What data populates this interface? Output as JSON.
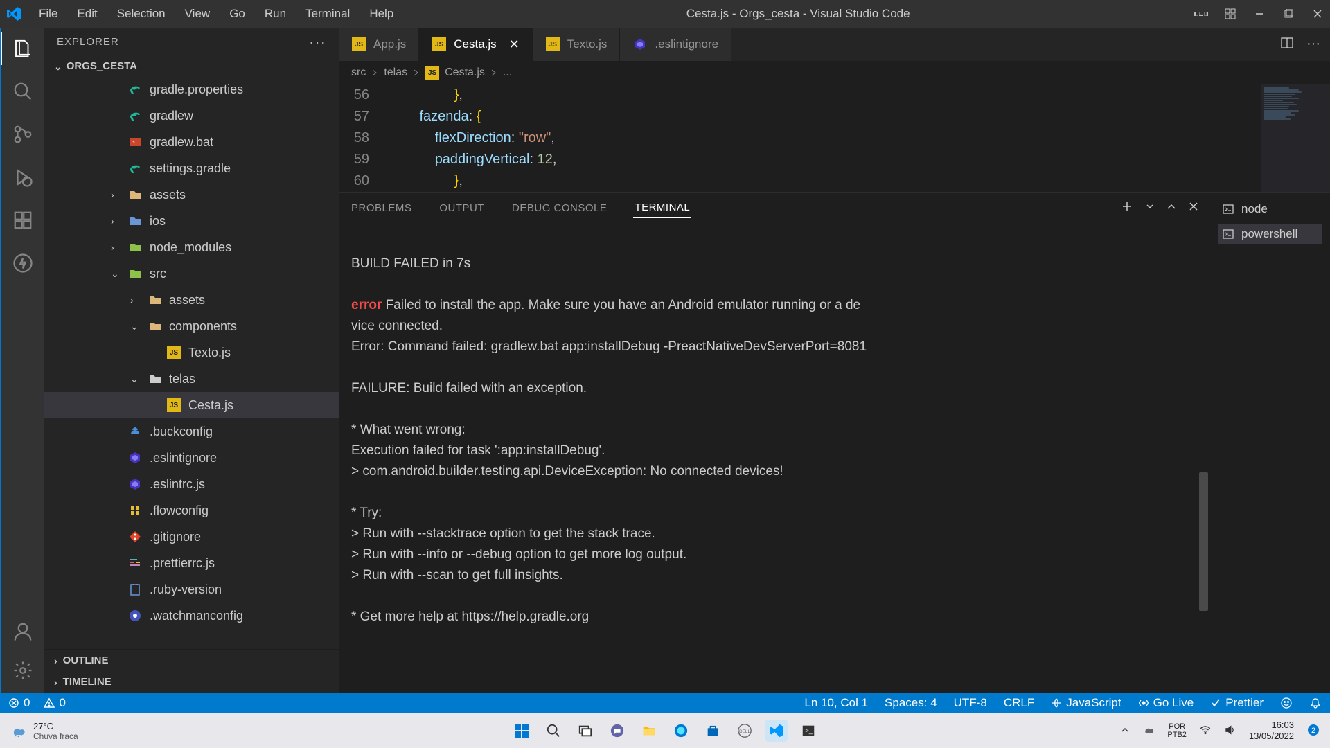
{
  "menu": [
    "File",
    "Edit",
    "Selection",
    "View",
    "Go",
    "Run",
    "Terminal",
    "Help"
  ],
  "window_title": "Cesta.js - Orgs_cesta - Visual Studio Code",
  "sidebar": {
    "header": "EXPLORER",
    "root": "ORGS_CESTA",
    "outline": "OUTLINE",
    "timeline": "TIMELINE"
  },
  "tree": [
    {
      "name": "gradle.properties",
      "indent": 0,
      "type": "file",
      "icon": "gradle"
    },
    {
      "name": "gradlew",
      "indent": 0,
      "type": "file",
      "icon": "gradle"
    },
    {
      "name": "gradlew.bat",
      "indent": 0,
      "type": "file",
      "icon": "bat"
    },
    {
      "name": "settings.gradle",
      "indent": 0,
      "type": "file",
      "icon": "gradle"
    },
    {
      "name": "assets",
      "indent": 0,
      "type": "folder",
      "open": false,
      "chevron": true,
      "color": "#dcb67a"
    },
    {
      "name": "ios",
      "indent": 0,
      "type": "folder",
      "open": false,
      "chevron": true,
      "color": "#6997d5"
    },
    {
      "name": "node_modules",
      "indent": 0,
      "type": "folder",
      "open": false,
      "chevron": true,
      "color": "#8dc149"
    },
    {
      "name": "src",
      "indent": 0,
      "type": "folder",
      "open": true,
      "chevron": true,
      "color": "#8dc149"
    },
    {
      "name": "assets",
      "indent": 1,
      "type": "folder",
      "open": false,
      "chevron": true,
      "color": "#dcb67a"
    },
    {
      "name": "components",
      "indent": 1,
      "type": "folder",
      "open": true,
      "chevron": true,
      "color": "#dcb67a"
    },
    {
      "name": "Texto.js",
      "indent": 2,
      "type": "file",
      "icon": "js"
    },
    {
      "name": "telas",
      "indent": 1,
      "type": "folder",
      "open": true,
      "chevron": true,
      "color": "#cccccc"
    },
    {
      "name": "Cesta.js",
      "indent": 2,
      "type": "file",
      "icon": "js",
      "selected": true
    },
    {
      "name": ".buckconfig",
      "indent": 0,
      "type": "file",
      "icon": "buck"
    },
    {
      "name": ".eslintignore",
      "indent": 0,
      "type": "file",
      "icon": "eslint"
    },
    {
      "name": ".eslintrc.js",
      "indent": 0,
      "type": "file",
      "icon": "eslint"
    },
    {
      "name": ".flowconfig",
      "indent": 0,
      "type": "file",
      "icon": "flow"
    },
    {
      "name": ".gitignore",
      "indent": 0,
      "type": "file",
      "icon": "git"
    },
    {
      "name": ".prettierrc.js",
      "indent": 0,
      "type": "file",
      "icon": "prettier"
    },
    {
      "name": ".ruby-version",
      "indent": 0,
      "type": "file",
      "icon": "ruby"
    },
    {
      "name": ".watchmanconfig",
      "indent": 0,
      "type": "file",
      "icon": "watchman"
    }
  ],
  "tabs": [
    {
      "label": "App.js",
      "icon": "js"
    },
    {
      "label": "Cesta.js",
      "icon": "js",
      "active": true,
      "close": true
    },
    {
      "label": "Texto.js",
      "icon": "js"
    },
    {
      "label": ".eslintignore",
      "icon": "eslint"
    }
  ],
  "breadcrumb": {
    "parts": [
      "src",
      "telas",
      "Cesta.js"
    ],
    "tail": "..."
  },
  "code": [
    {
      "n": 56,
      "seg": [
        {
          "t": "            ",
          "c": ""
        },
        {
          "t": "}",
          "c": "c-brace"
        },
        {
          "t": ",",
          "c": "c-punc"
        }
      ]
    },
    {
      "n": 57,
      "seg": [
        {
          "t": "        ",
          "c": ""
        },
        {
          "t": "fazenda",
          "c": "c-key"
        },
        {
          "t": ": ",
          "c": "c-punc"
        },
        {
          "t": "{",
          "c": "c-brace"
        }
      ]
    },
    {
      "n": 58,
      "seg": [
        {
          "t": "            ",
          "c": ""
        },
        {
          "t": "flexDirection",
          "c": "c-key"
        },
        {
          "t": ": ",
          "c": "c-punc"
        },
        {
          "t": "\"row\"",
          "c": "c-str"
        },
        {
          "t": ",",
          "c": "c-punc"
        }
      ]
    },
    {
      "n": 59,
      "seg": [
        {
          "t": "            ",
          "c": ""
        },
        {
          "t": "paddingVertical",
          "c": "c-key"
        },
        {
          "t": ": ",
          "c": "c-punc"
        },
        {
          "t": "12",
          "c": "c-num"
        },
        {
          "t": ",",
          "c": "c-punc"
        }
      ]
    },
    {
      "n": 60,
      "seg": [
        {
          "t": "            ",
          "c": ""
        },
        {
          "t": "}",
          "c": "c-brace"
        },
        {
          "t": ",",
          "c": "c-punc"
        }
      ]
    }
  ],
  "panel_tabs": {
    "problems": "PROBLEMS",
    "output": "OUTPUT",
    "debug": "DEBUG CONSOLE",
    "terminal": "TERMINAL"
  },
  "terminal_lines": [
    "",
    "BUILD FAILED in 7s",
    "",
    {
      "err": "error",
      "text": " Failed to install the app. Make sure you have an Android emulator running or a de"
    },
    "vice connected.",
    "Error: Command failed: gradlew.bat app:installDebug -PreactNativeDevServerPort=8081",
    "",
    "FAILURE: Build failed with an exception.",
    "",
    "* What went wrong:",
    "Execution failed for task ':app:installDebug'.",
    "> com.android.builder.testing.api.DeviceException: No connected devices!",
    "",
    "* Try:",
    "> Run with --stacktrace option to get the stack trace.",
    "> Run with --info or --debug option to get more log output.",
    "> Run with --scan to get full insights.",
    "",
    "* Get more help at https://help.gradle.org"
  ],
  "terminals": [
    {
      "label": "node"
    },
    {
      "label": "powershell",
      "active": true
    }
  ],
  "status": {
    "errors": "0",
    "warnings": "0",
    "position": "Ln 10, Col 1",
    "spaces": "Spaces: 4",
    "encoding": "UTF-8",
    "eol": "CRLF",
    "lang": "JavaScript",
    "golive": "Go Live",
    "prettier": "Prettier"
  },
  "taskbar": {
    "temp": "27°C",
    "weather": "Chuva fraca",
    "lang1": "POR",
    "lang2": "PTB2",
    "time": "16:03",
    "date": "13/05/2022"
  }
}
